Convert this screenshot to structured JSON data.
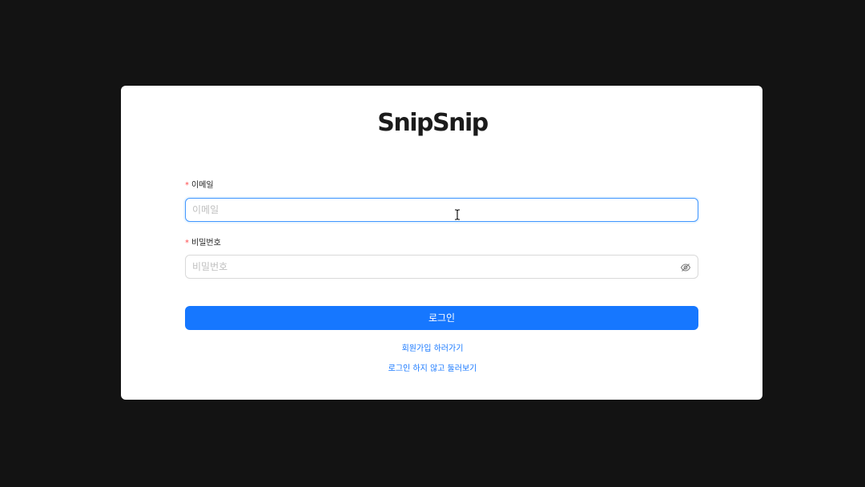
{
  "brand": {
    "logo_text": "SnipSnip"
  },
  "form": {
    "email": {
      "required_mark": "*",
      "label": "이메일",
      "placeholder": "이메일",
      "value": ""
    },
    "password": {
      "required_mark": "*",
      "label": "비밀번호",
      "placeholder": "비밀번호",
      "value": "",
      "toggle_icon": "eye-invisible-icon"
    },
    "submit_label": "로그인"
  },
  "links": {
    "signup": "회원가입 하러가기",
    "browse_without_login": "로그인 하지 않고 둘러보기"
  },
  "colors": {
    "background": "#131313",
    "card": "#ffffff",
    "primary": "#1677ff",
    "required": "#ff4d4f",
    "focus_border": "#4096ff"
  }
}
